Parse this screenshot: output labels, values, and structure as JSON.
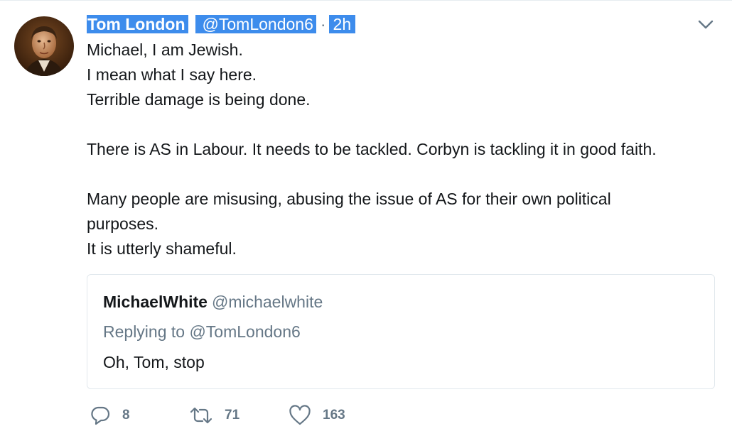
{
  "tweet": {
    "author": {
      "name": "Tom London",
      "handle": "@TomLondon6",
      "avatar_icon": "portrait-avatar"
    },
    "time_sep": "·",
    "time": "2h",
    "body_lines": [
      "Michael, I am Jewish.",
      "I mean what I say here.",
      "Terrible damage is being done.",
      "",
      "There is AS in Labour. It needs to be tackled. Corbyn is tackling it in good faith.",
      "",
      "Many people are misusing, abusing the issue of AS for their own political",
      "purposes.",
      "It is utterly shameful."
    ],
    "caret_icon": "chevron-down-icon"
  },
  "quote": {
    "name": "MichaelWhite",
    "handle": "@michaelwhite",
    "replying_to": "Replying to @TomLondon6",
    "text": "Oh, Tom, stop"
  },
  "actions": {
    "reply": {
      "icon": "reply-icon",
      "count": "8"
    },
    "retweet": {
      "icon": "retweet-icon",
      "count": "71"
    },
    "like": {
      "icon": "heart-icon",
      "count": "163"
    }
  },
  "colors": {
    "selection": "#3d8cec",
    "muted": "#657786",
    "text": "#14171a",
    "border": "#e1e8ed"
  }
}
